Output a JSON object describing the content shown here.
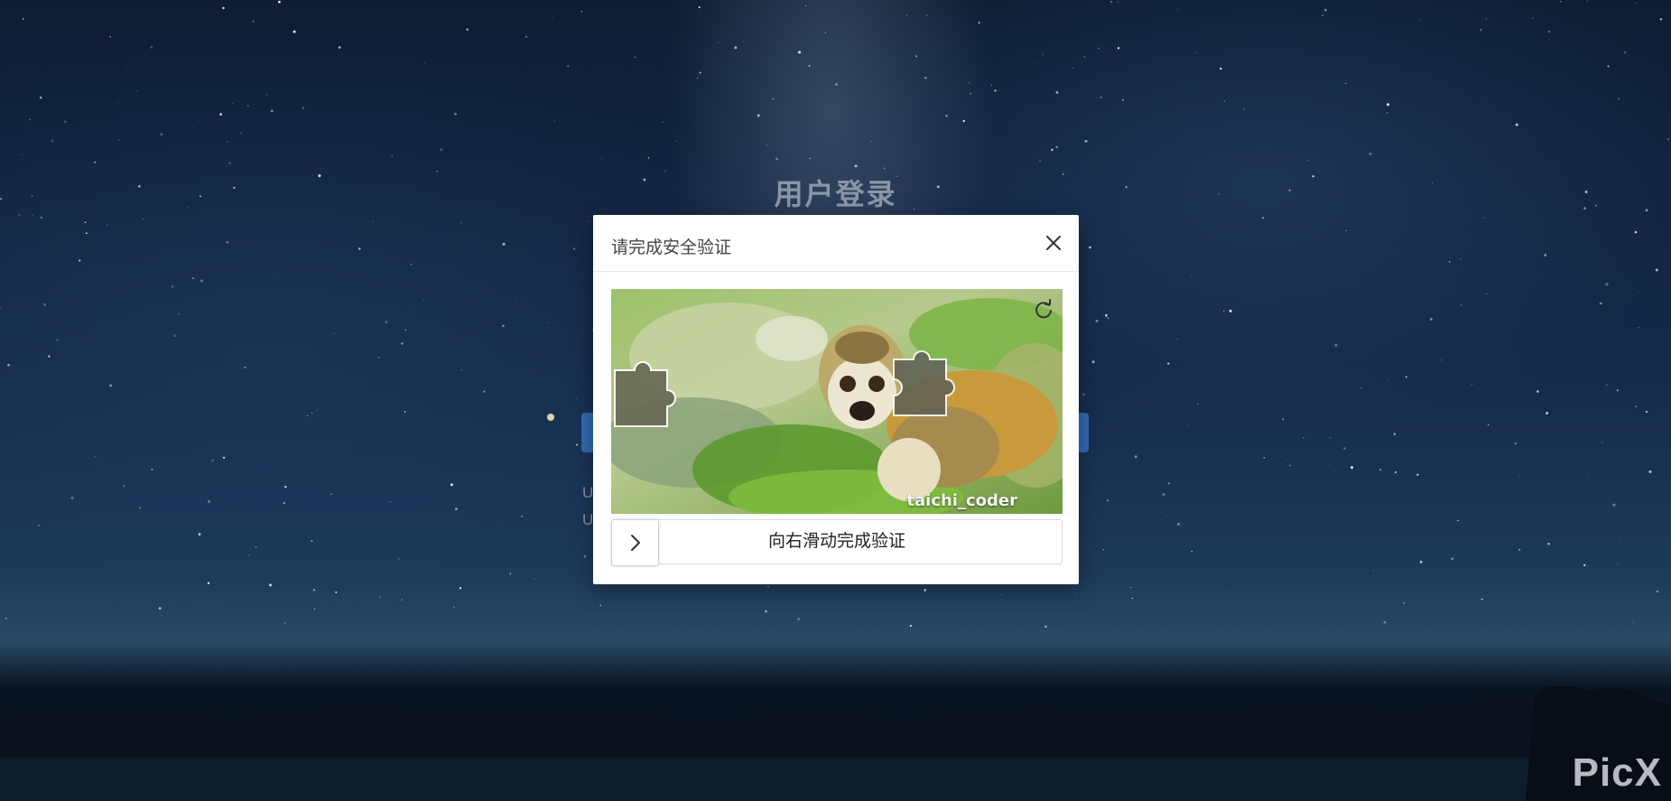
{
  "page": {
    "title": "用户登录",
    "behind_text_1": "U",
    "behind_text_2": "U",
    "watermark": "PicX"
  },
  "dialog": {
    "title": "请完成安全验证",
    "close_icon": "close-icon",
    "refresh_icon": "refresh-icon",
    "image_caption": "taichi_coder",
    "slider_label": "向右滑动完成验证",
    "slider_icon": "chevron-right-icon",
    "slider_progress": 0
  },
  "colors": {
    "accent": "#2f6bb0",
    "dialog_bg": "#ffffff"
  }
}
